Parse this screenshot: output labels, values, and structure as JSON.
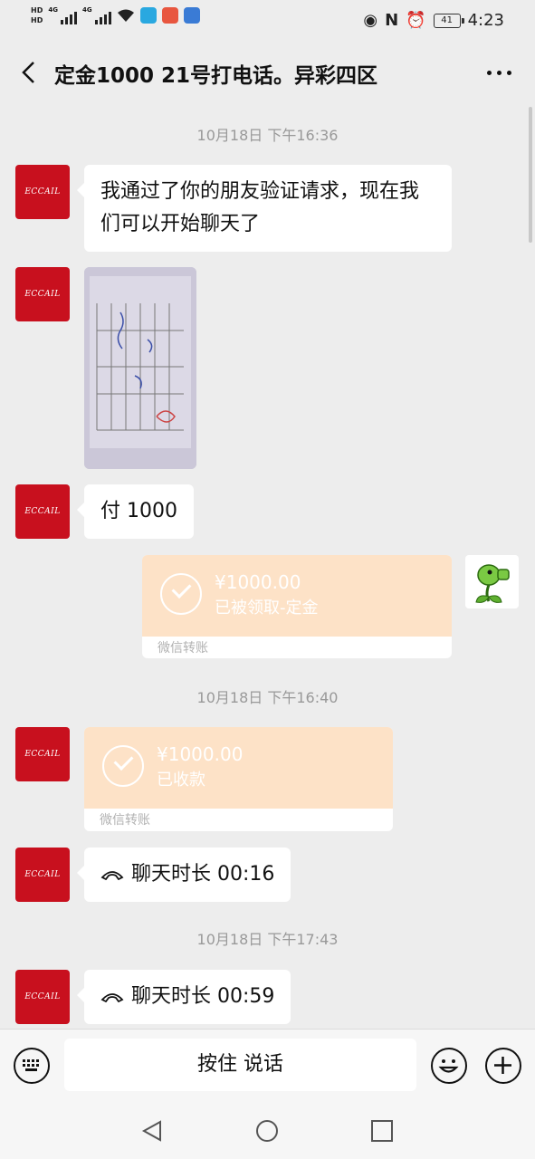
{
  "status_bar": {
    "hd1": "HD",
    "hd2": "HD",
    "net1": "4G",
    "net2": "4G",
    "battery": "41",
    "time": "4:23"
  },
  "header": {
    "title": "定金1000 21号打电话。异彩四区"
  },
  "avatar_logo_text": "ECCAIL",
  "messages": {
    "ts1": "10月18日 下午16:36",
    "m1_text": "我通过了你的朋友验证请求，现在我们可以开始聊天了",
    "m3_text": "付 1000",
    "transfer1": {
      "amount": "¥1000.00",
      "status": "已被领取-定金",
      "footer": "微信转账"
    },
    "ts2": "10月18日 下午16:40",
    "transfer2": {
      "amount": "¥1000.00",
      "status": "已收款",
      "footer": "微信转账"
    },
    "call1": "聊天时长 00:16",
    "ts3": "10月18日 下午17:43",
    "call2": "聊天时长 00:59"
  },
  "input_bar": {
    "speak_label": "按住 说话"
  },
  "icons": [
    "back-icon",
    "more-icon",
    "voice-icon",
    "emoji-icon",
    "plus-icon",
    "call-icon",
    "nav-back-icon",
    "nav-home-icon",
    "nav-recents-icon"
  ],
  "colors": {
    "background": "#ededed",
    "transfer_orange": "#fde2c7",
    "avatar_red": "#c8101e"
  }
}
